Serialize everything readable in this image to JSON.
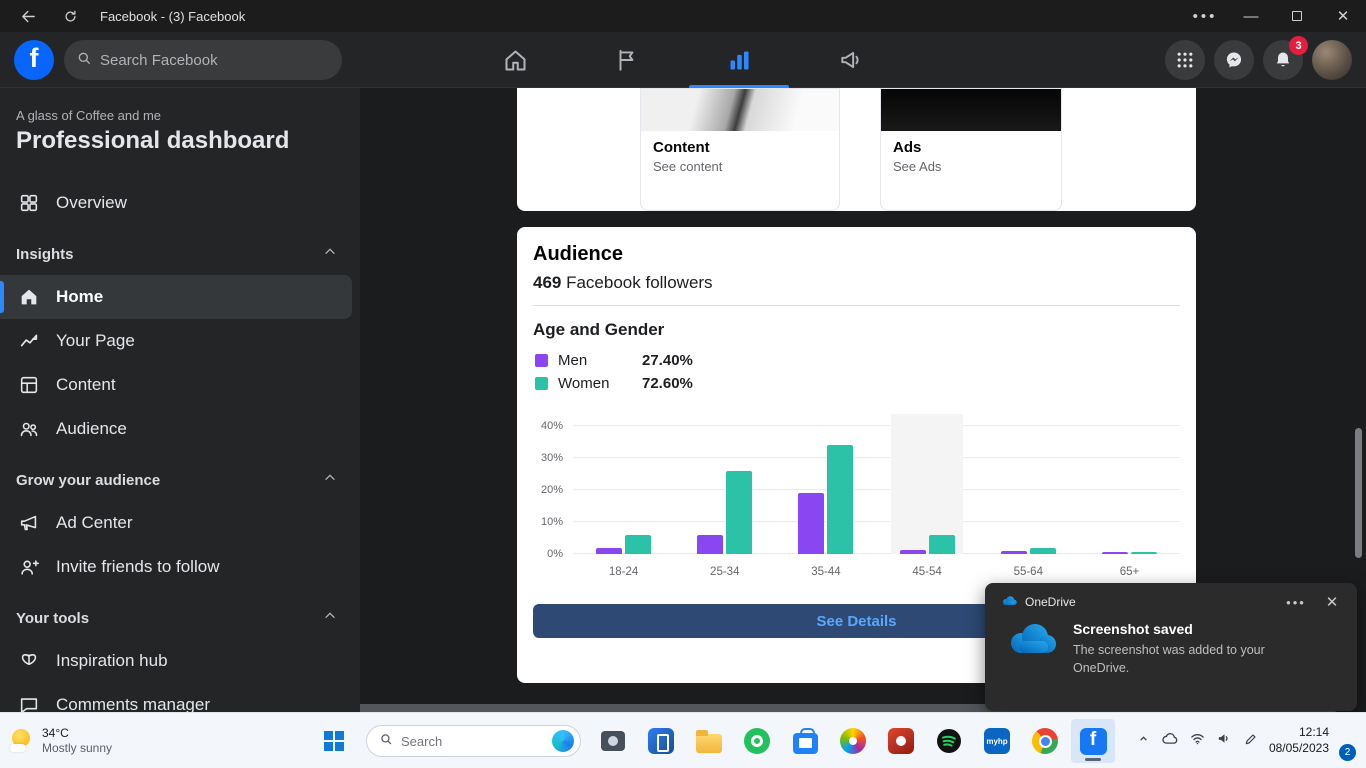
{
  "titlebar": {
    "title": "Facebook - (3) Facebook"
  },
  "fb_header": {
    "logo_letter": "f",
    "search_placeholder": "Search Facebook",
    "notifications_badge": "3"
  },
  "sidebar": {
    "page_name": "A glass of Coffee and me",
    "title": "Professional dashboard",
    "overview_label": "Overview",
    "sections": [
      {
        "label": "Insights",
        "items": [
          "Home",
          "Your Page",
          "Content",
          "Audience"
        ]
      },
      {
        "label": "Grow your audience",
        "items": [
          "Ad Center",
          "Invite friends to follow"
        ]
      },
      {
        "label": "Your tools",
        "items": [
          "Inspiration hub",
          "Comments manager"
        ]
      }
    ],
    "active_item": "Home"
  },
  "main": {
    "top_cards": [
      {
        "title": "Content",
        "subtitle": "See content"
      },
      {
        "title": "Ads",
        "subtitle": "See Ads"
      }
    ],
    "audience": {
      "title": "Audience",
      "followers_count": "469",
      "followers_label": " Facebook followers",
      "see_details": "See Details"
    }
  },
  "chart_data": {
    "type": "bar",
    "title": "Age and Gender",
    "categories": [
      "18-24",
      "25-34",
      "35-44",
      "45-54",
      "55-64",
      "65+"
    ],
    "series": [
      {
        "name": "Men",
        "share_label": "27.40%",
        "color": "#8a46f0",
        "values": [
          2,
          6,
          19,
          1.2,
          0.8,
          0.4
        ]
      },
      {
        "name": "Women",
        "share_label": "72.60%",
        "color": "#2bc2a8",
        "values": [
          6,
          26,
          34,
          6,
          2,
          0.5
        ]
      }
    ],
    "yticks": [
      0,
      10,
      20,
      30,
      40
    ],
    "ylim": [
      0,
      45
    ],
    "grid": true,
    "legend_position": "top-left",
    "highlighted_category": "45-54"
  },
  "toast": {
    "app_name": "OneDrive",
    "title": "Screenshot saved",
    "message": "The screenshot was added to your OneDrive."
  },
  "taskbar": {
    "weather_temp": "34°C",
    "weather_desc": "Mostly sunny",
    "search_placeholder": "Search",
    "myhp_label": "myhp",
    "time": "12:14",
    "date": "08/05/2023",
    "notifications_count": "2",
    "apps": [
      "camera",
      "phone-link",
      "file-explorer",
      "green-app",
      "microsoft-store",
      "photos",
      "red-app",
      "spotify",
      "myhp",
      "chrome",
      "facebook"
    ]
  },
  "colors": {
    "accent_blue": "#2d88ff",
    "facebook_blue": "#1877f2"
  }
}
